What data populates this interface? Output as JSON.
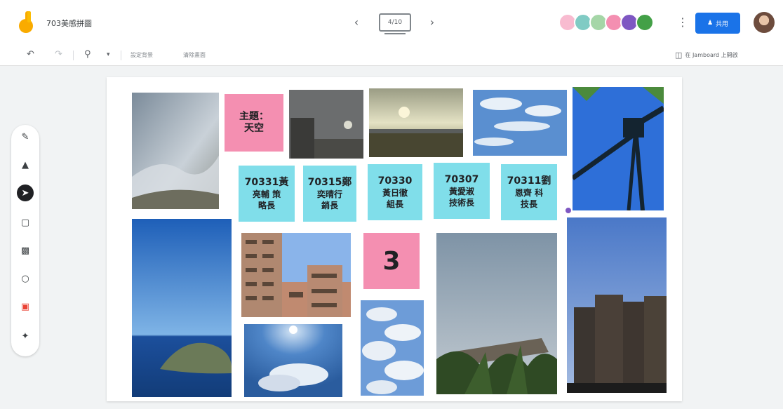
{
  "header": {
    "doc_title": "703美感拼圖",
    "frame_indicator": "4/10",
    "share_label": "共用",
    "prev_icon": "chevron-left-icon",
    "next_icon": "chevron-right-icon"
  },
  "toolbar": {
    "clear_frame": "設定背景",
    "reset_frame": "清除畫面",
    "open_in_jamboard": "在 Jamboard 上開啟",
    "zoom_icon": "zoom-icon",
    "undo_icon": "undo-icon",
    "redo_icon": "redo-icon"
  },
  "collaborators": [
    {
      "color": "#f8bbd0"
    },
    {
      "color": "#80cbc4"
    },
    {
      "color": "#a5d6a7"
    },
    {
      "color": "#f48fb1"
    },
    {
      "color": "#7e57c2"
    },
    {
      "color": "#43a047"
    }
  ],
  "tools": [
    "pen-icon",
    "eraser-icon",
    "select-icon",
    "sticky-note-icon",
    "image-icon",
    "circle-icon",
    "text-box-icon",
    "laser-icon"
  ],
  "stickies": {
    "theme": {
      "line1": "主題：",
      "line2": "天空"
    },
    "s1": {
      "id": "70331黃",
      "name": "亮輔 策",
      "role": "略長"
    },
    "s2": {
      "id": "70315鄭",
      "name": "奕晴行",
      "role": "銷長"
    },
    "s3": {
      "id": "70330",
      "name": "黃日徹",
      "role": "組長"
    },
    "s4": {
      "id": "70307",
      "name": "黃愛淑",
      "role": "技術長"
    },
    "s5": {
      "id": "70311劉",
      "name": "恩齊 科",
      "role": "技長"
    },
    "number": "3"
  }
}
